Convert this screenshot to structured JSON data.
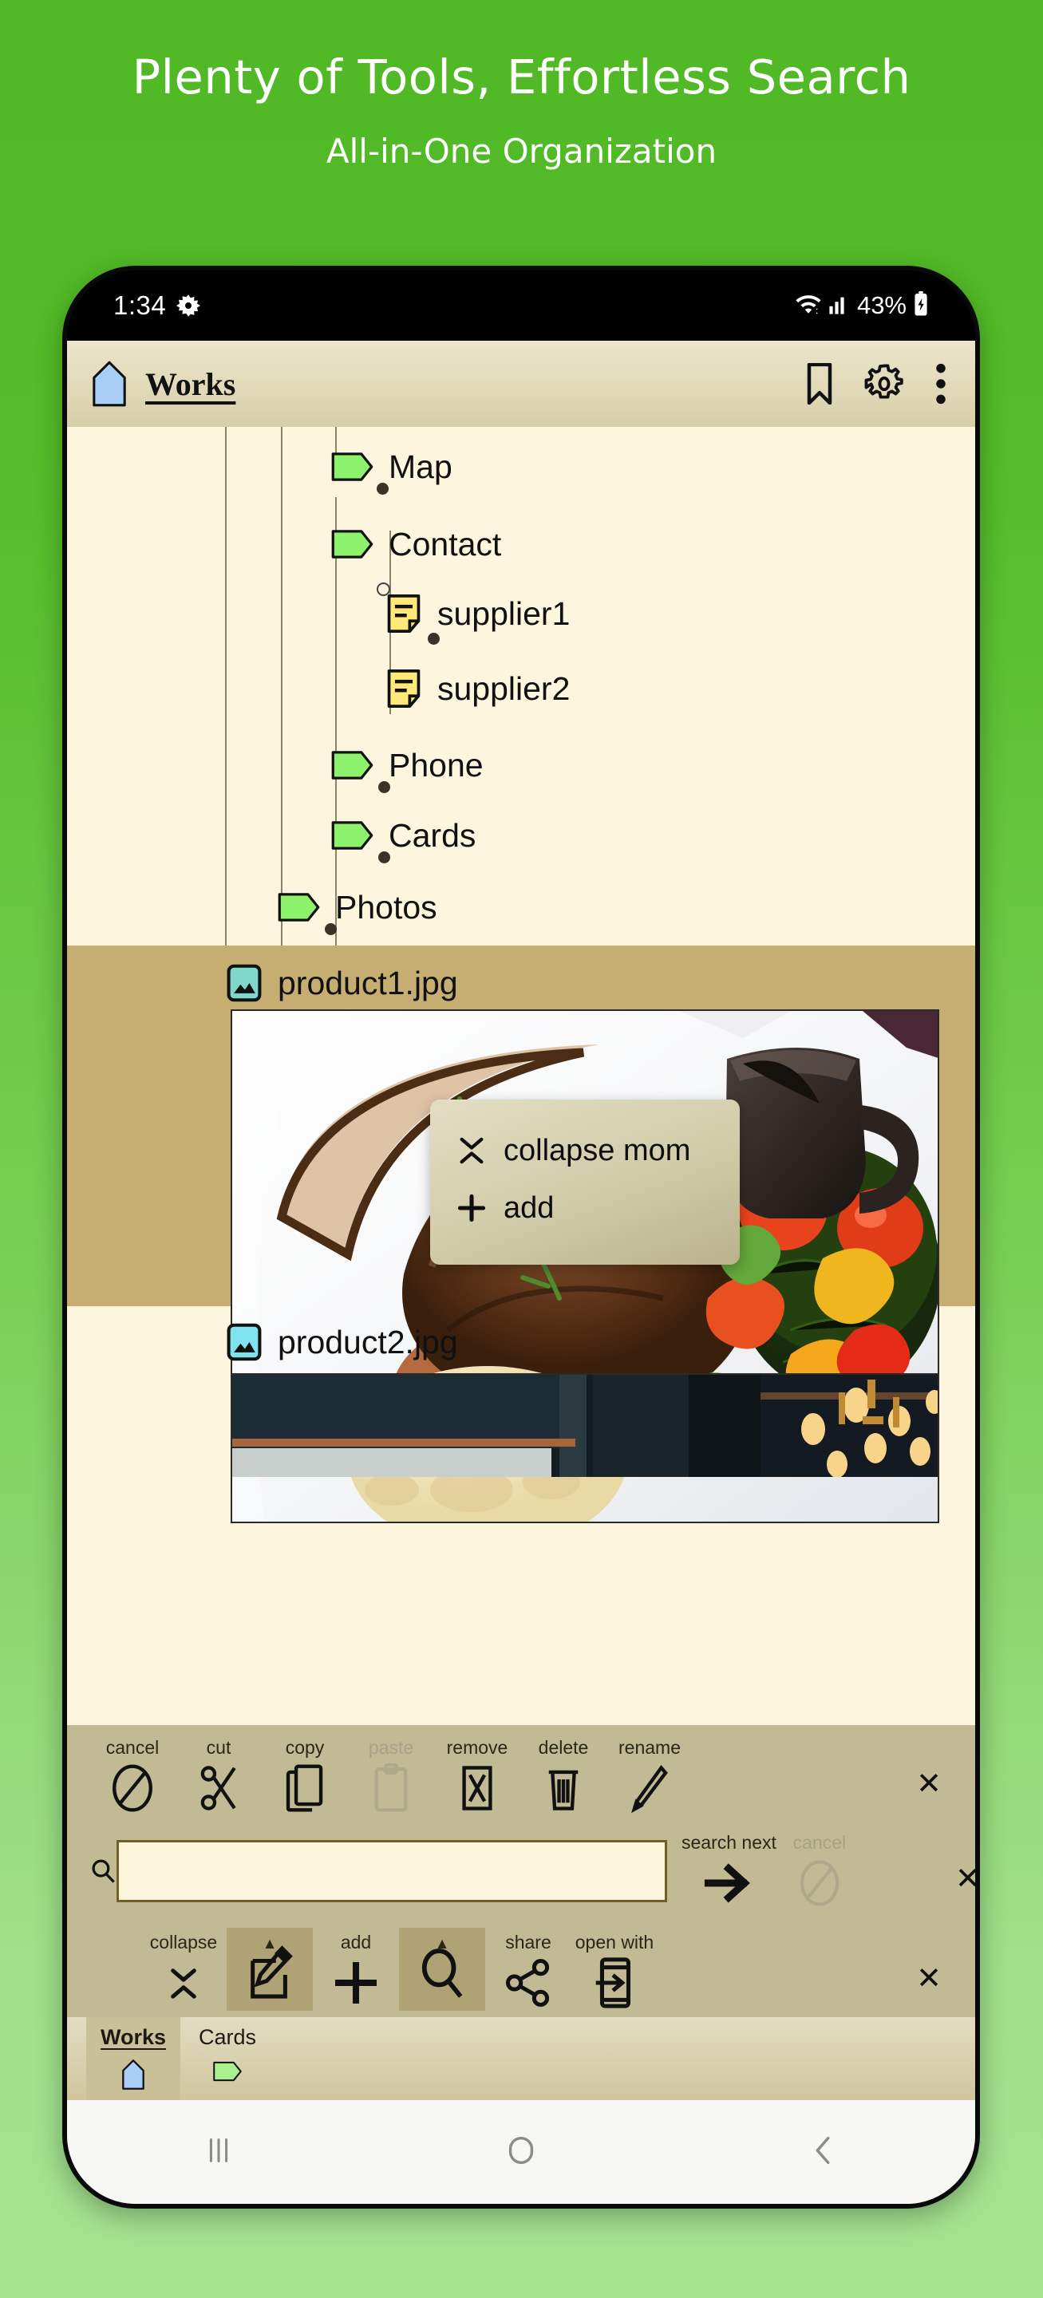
{
  "promo": {
    "title": "Plenty of Tools, Effortless Search",
    "subtitle": "All-in-One Organization"
  },
  "statusbar": {
    "time": "1:34",
    "brightness_icon": "brightness-icon",
    "wifi_icon": "wifi-icon",
    "signal_icon": "cellular-signal-icon",
    "battery_percent": "43%",
    "battery_icon": "battery-charging-icon"
  },
  "appbar": {
    "home_icon": "home-icon",
    "title": "Works",
    "bookmark_icon": "bookmark-icon",
    "settings_icon": "gear-icon",
    "overflow_icon": "more-vertical-icon"
  },
  "tree": {
    "items": [
      {
        "label": "Map",
        "type": "folder",
        "depth": 3
      },
      {
        "label": "Contact",
        "type": "folder",
        "depth": 3
      },
      {
        "label": "supplier1",
        "type": "note",
        "depth": 4
      },
      {
        "label": "supplier2",
        "type": "note",
        "depth": 4
      },
      {
        "label": "Phone",
        "type": "folder",
        "depth": 3
      },
      {
        "label": "Cards",
        "type": "folder",
        "depth": 3
      },
      {
        "label": "Photos",
        "type": "folder",
        "depth": 2
      },
      {
        "label": "product1.jpg",
        "type": "image",
        "depth": 3,
        "selected": true
      },
      {
        "label": "product2.jpg",
        "type": "image",
        "depth": 3,
        "selected": false
      }
    ]
  },
  "popup": {
    "items": [
      {
        "label": "collapse mom",
        "icon": "collapse-icon"
      },
      {
        "label": "add",
        "icon": "plus-icon"
      }
    ]
  },
  "toolbar_edit": {
    "items": [
      {
        "label": "cancel",
        "icon": "cancel-icon",
        "disabled": false
      },
      {
        "label": "cut",
        "icon": "scissors-icon",
        "disabled": false
      },
      {
        "label": "copy",
        "icon": "copy-icon",
        "disabled": false
      },
      {
        "label": "paste",
        "icon": "clipboard-icon",
        "disabled": true
      },
      {
        "label": "remove",
        "icon": "remove-icon",
        "disabled": false
      },
      {
        "label": "delete",
        "icon": "trash-icon",
        "disabled": false
      },
      {
        "label": "rename",
        "icon": "pencil-icon",
        "disabled": false
      }
    ],
    "close_label": "✕"
  },
  "toolbar_search": {
    "search_icon": "search-icon",
    "input_value": "",
    "input_placeholder": "",
    "next_label": "search next",
    "next_icon": "arrow-right-icon",
    "cancel_label": "cancel",
    "cancel_icon": "cancel-icon",
    "close_label": "✕"
  },
  "toolbar_actions": {
    "items": [
      {
        "label": "collapse",
        "icon": "collapse-icon",
        "active": false
      },
      {
        "label": "",
        "icon": "edit-icon",
        "active": true
      },
      {
        "label": "add",
        "icon": "plus-icon",
        "active": false
      },
      {
        "label": "",
        "icon": "search-icon",
        "active": true
      },
      {
        "label": "share",
        "icon": "share-icon",
        "active": false
      },
      {
        "label": "open with",
        "icon": "open-with-icon",
        "active": false
      }
    ],
    "close_label": "✕"
  },
  "tabs": [
    {
      "label": "Works",
      "icon": "home-icon",
      "active": true
    },
    {
      "label": "Cards",
      "icon": "folder-icon",
      "active": false
    }
  ],
  "navbar": {
    "recents_icon": "recents-icon",
    "home_icon": "home-circle-icon",
    "back_icon": "back-chevron-icon"
  },
  "colors": {
    "brand_green": "#4FB824",
    "paper": "#FDF5DD",
    "selection": "#C6AE72",
    "toolbar": "#C2BA94",
    "folder_green": "#8CF26B",
    "note_yellow": "#FFE977",
    "image_teal": "#7FD6CB",
    "image_cyan": "#7FE2EF"
  }
}
